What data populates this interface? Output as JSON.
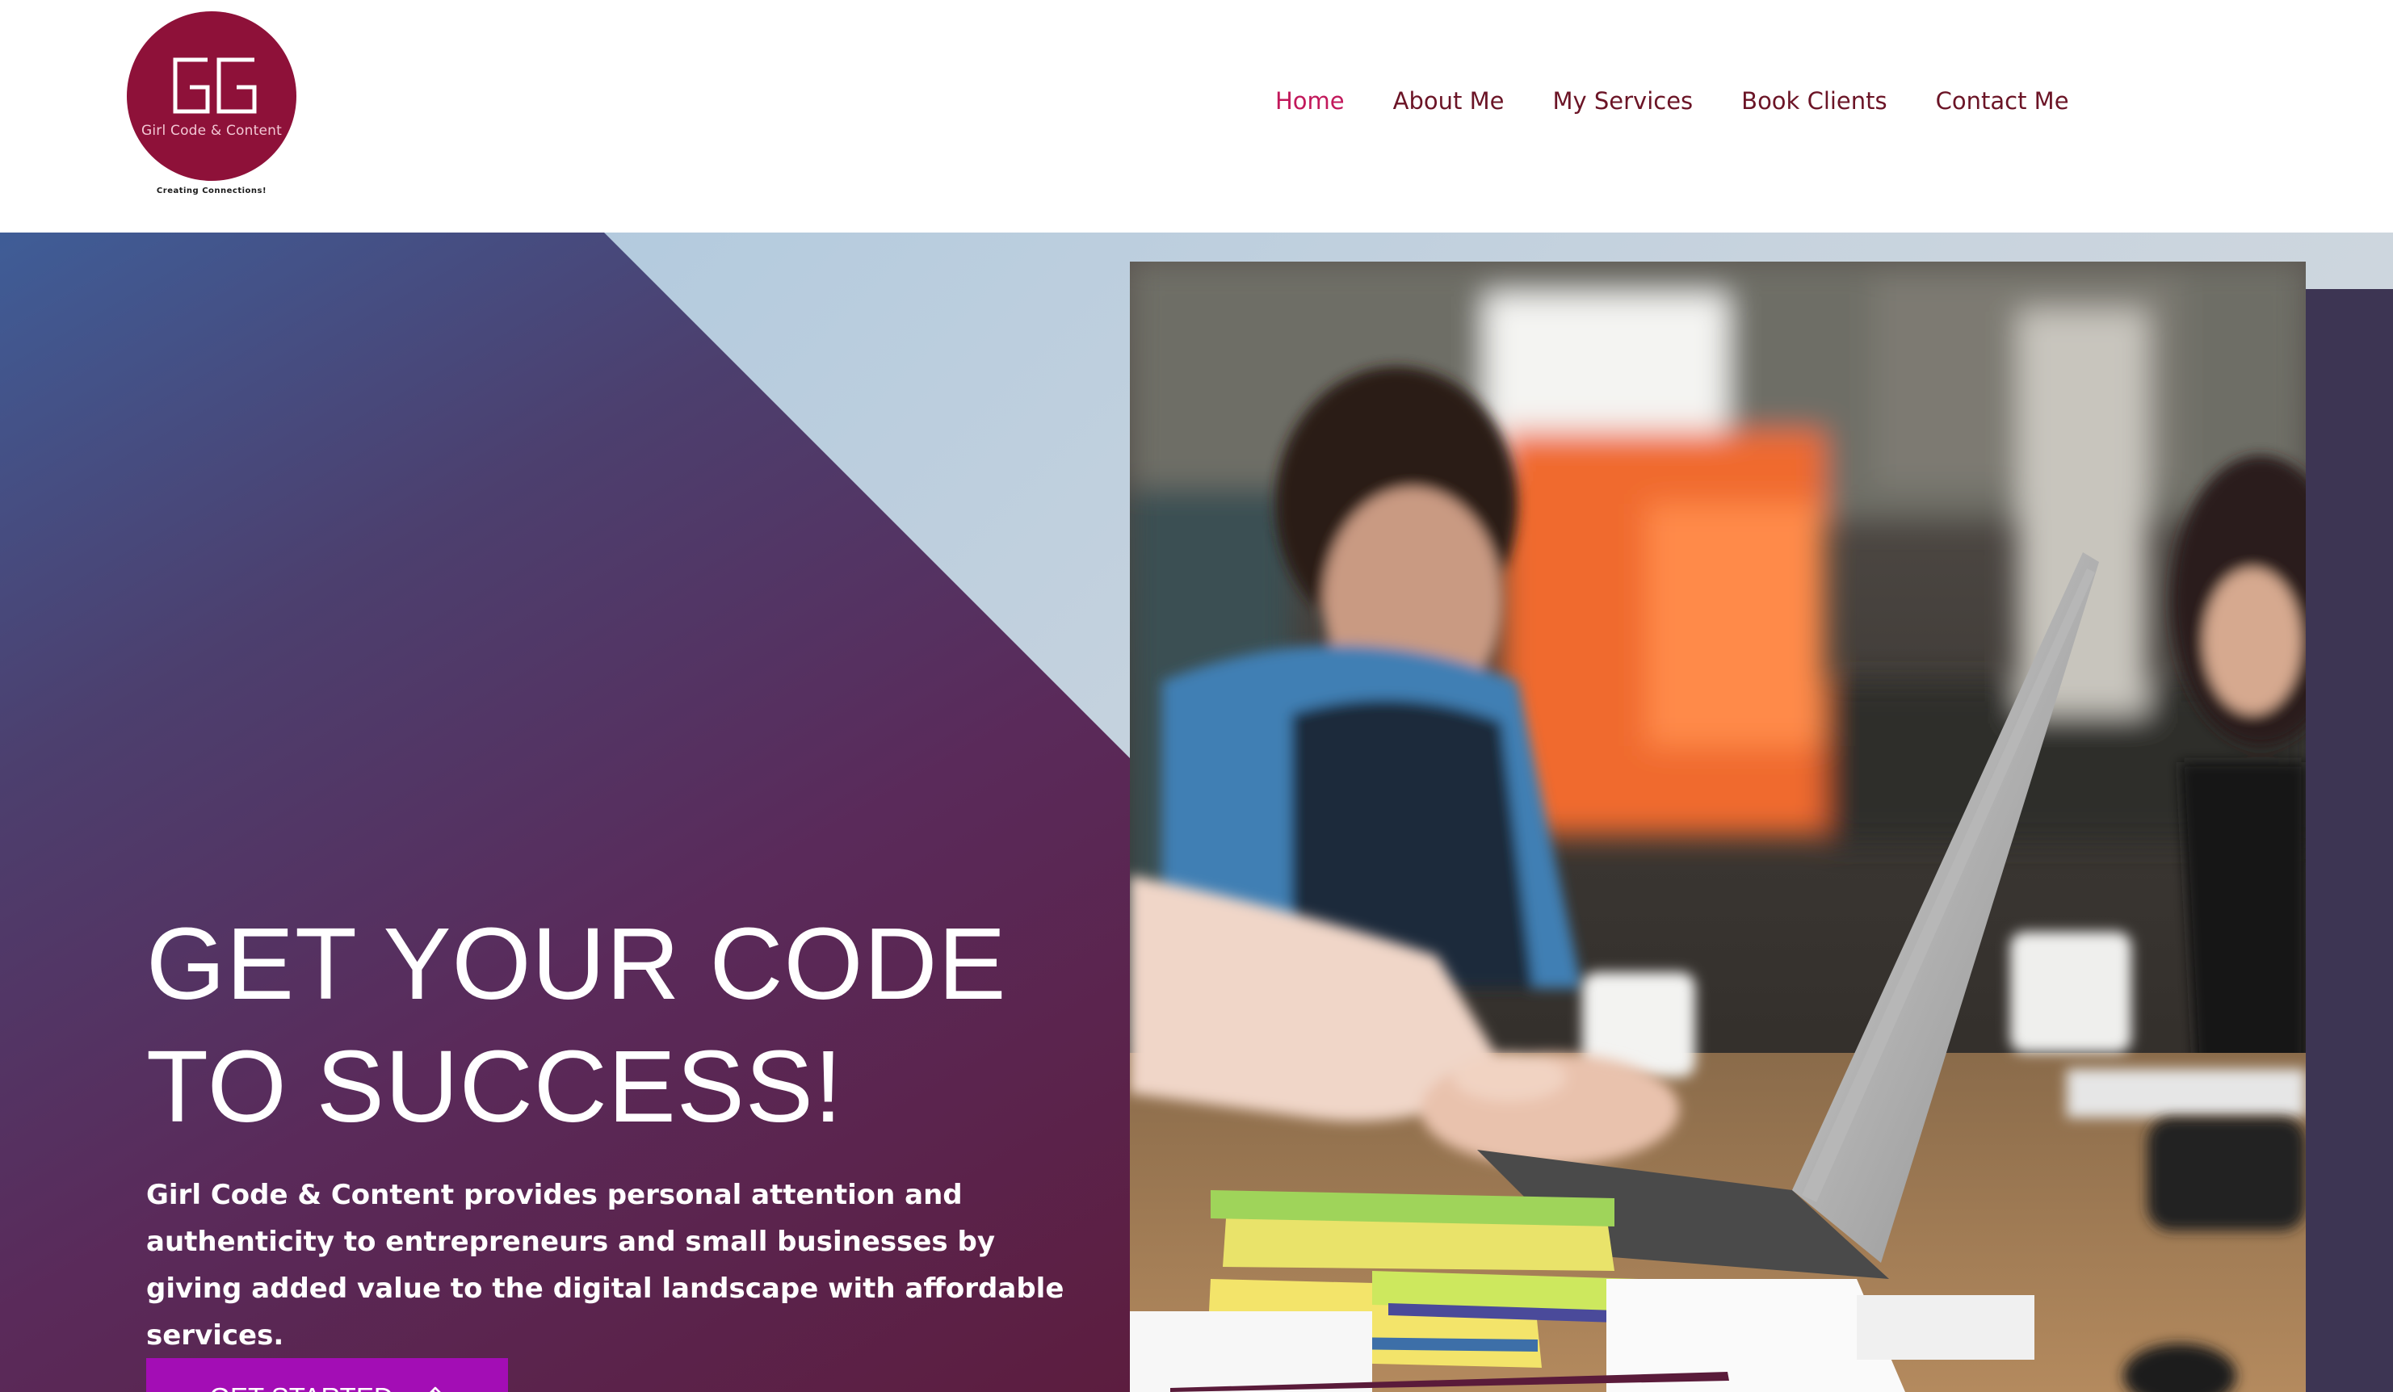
{
  "brand": {
    "logo_initials": "GG",
    "logo_name": "Girl Code & Content",
    "tagline": "Creating Connections!",
    "logo_color": "#8e1139"
  },
  "nav": {
    "items": [
      {
        "label": "Home",
        "active": true
      },
      {
        "label": "About Me",
        "active": false
      },
      {
        "label": "My Services",
        "active": false
      },
      {
        "label": "Book Clients",
        "active": false
      },
      {
        "label": "Contact Me",
        "active": false
      }
    ],
    "active_color": "#c2185b",
    "color": "#6b1426"
  },
  "hero": {
    "title_line1": "GET YOUR CODE",
    "title_line2": "TO SUCCESS!",
    "description": "Girl Code & Content provides personal attention and authenticity to entrepreneurs and small businesses by giving added value to the digital landscape with affordable services.",
    "cta_label": "GET STARTED",
    "cta_icon": "pencil-icon",
    "cta_color": "#a30db5",
    "photo_alt": "People working on laptops in a cafe"
  }
}
